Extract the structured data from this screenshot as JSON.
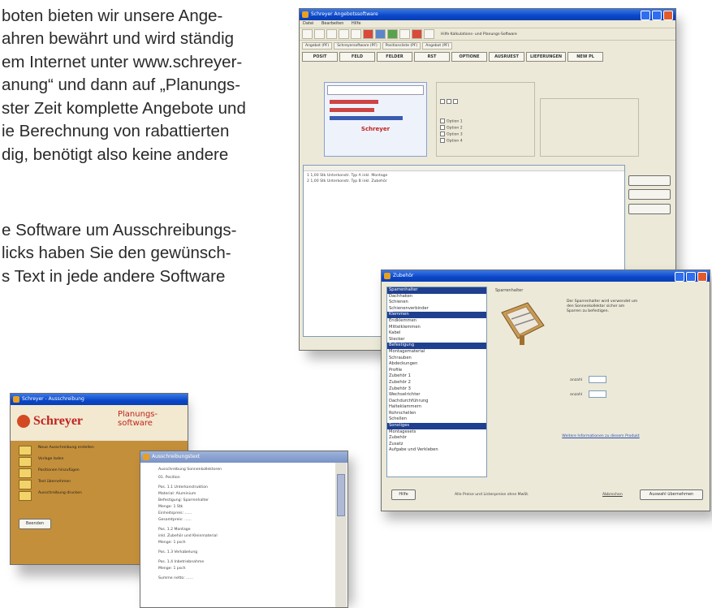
{
  "text_lines": [
    "boten bieten wir unsere Ange-",
    "ahren bewährt und wird ständig",
    "em Internet unter www.schreyer-",
    "anung“ und dann auf „Planungs-",
    "ster Zeit komplette Angebote und",
    "ie Berechnung von rabattierten",
    "dig, benötigt also keine andere",
    "e Software um Ausschreibungs-",
    "licks haben Sie den gewünsch-",
    "s Text in jede andere Software"
  ],
  "shot_main": {
    "title": "Schreyer Angebotssoftware",
    "menu": [
      "Datei",
      "Bearbeiten",
      "Hilfe"
    ],
    "url": "Hilfe Kalkulations- und Planungs-Software",
    "tabs_small": [
      "Angebot (PF)",
      "Schreyersoftware (PF)",
      "Positionsliste (PF)",
      "Angebot (PF)"
    ],
    "tabs_main": [
      "POSIT",
      "FELD",
      "FELDER",
      "RST",
      "OPTIONE",
      "AUSRUEST",
      "LIEFERUNGEN",
      "NEW PL"
    ],
    "logo": "Schreyer",
    "table_rows": [
      "1      1,00   Stk   Unterkonstr. Typ A   inkl. Montage",
      "2      1,00   Stk   Unterkonstr. Typ B   inkl. Zubehör"
    ]
  },
  "shot_dialog": {
    "title": "Zubehör",
    "list_items": [
      "Sparrenhalter",
      "Dachhaken",
      "Schienen",
      "Schienenverbinder",
      "Klemmen",
      "Endklemmen",
      "Mittelklemmen",
      "Kabel",
      "Stecker",
      "Befestigung",
      "Montagematerial",
      "Schrauben",
      "Abdeckungen",
      "Profile",
      "Zubehör 1",
      "Zubehör 2",
      "Zubehör 3",
      "Wechselrichter",
      "Dachdurchführung",
      "Halteklammern",
      "Rohrschellen",
      "Schellen",
      "Sonstiges",
      "Montagesets",
      "Zubehör",
      "Zusatz",
      "Aufgabe und Verkleben"
    ],
    "caption": "Sparrenhalter",
    "desc": "Der Sparrenhalter wird verwendet um den Sonnenkollektor sicher am Sparren zu befestigen.",
    "link": "Weitere Informationen zu diesem Produkt",
    "btn_help": "Hilfe",
    "footer": "Alle Preise und Listenpreise ohne MwSt.",
    "btn_cancel": "Abbrechen",
    "btn_ok": "Auswahl übernehmen"
  },
  "shot_left": {
    "title": "Schreyer - Ausschreibung",
    "logo": "Schreyer",
    "logo_sub": "Planungs-software",
    "options": [
      "Neue Ausschreibung erstellen",
      "Vorlage laden",
      "Positionen hinzufügen",
      "Text übernehmen",
      "Ausschreibung drucken"
    ],
    "btn": "Beenden"
  },
  "shot_text": {
    "title": "Ausschreibungstext",
    "lines": [
      "Ausschreibung Sonnenkollektoren",
      "01. Position",
      "Pos. 1.1 Unterkonstruktion",
      "Material: Aluminium",
      "Befestigung: Sparrenhalter",
      "Menge: 1 Stk",
      "Einheitspreis: ......",
      "Gesamtpreis: ......",
      "Pos. 1.2 Montage",
      "inkl. Zubehör und Kleinmaterial",
      "Menge: 1 psch",
      "Pos. 1.3 Verkabelung",
      "Pos. 1.4 Inbetriebnahme",
      "Menge: 1 psch",
      "Summe netto: ......"
    ]
  }
}
